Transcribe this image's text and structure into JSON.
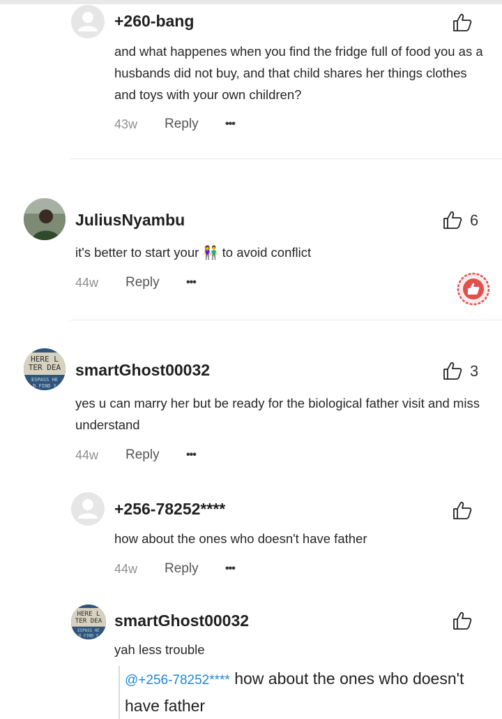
{
  "comments": [
    {
      "username": "+260-bang",
      "text": "and what happenes when you find the fridge full of food you as  a husbands did not buy, and that child shares her things clothes and toys with your own children?",
      "time": "43w",
      "reply_label": "Reply",
      "more": "•••",
      "likes": ""
    },
    {
      "username": "JuliusNyambu",
      "text_before": "it's better to start your",
      "emoji": "👫",
      "text_after": " to avoid conflict",
      "time": "44w",
      "reply_label": "Reply",
      "more": "•••",
      "likes": "6"
    },
    {
      "username": "smartGhost00032",
      "text": "yes u can marry her but be ready for the biological father visit and miss understand",
      "time": "44w",
      "reply_label": "Reply",
      "more": "•••",
      "likes": "3"
    },
    {
      "username": "+256-78252****",
      "text": "how about the ones who doesn't have father",
      "time": "44w",
      "reply_label": "Reply",
      "more": "•••",
      "likes": ""
    },
    {
      "username": "smartGhost00032",
      "text": "yah less trouble",
      "quote_mention": "@+256-78252****",
      "quote_text": " how about the ones who doesn't have father",
      "likes": ""
    }
  ],
  "avatar_text": {
    "ghost_line1": "HERE L",
    "ghost_line2": "TER DEA",
    "ghost_line3": "ESPASS HE",
    "ghost_line4": "D FIND Y"
  },
  "colors": {
    "accent_link": "#1f86d6",
    "badge_red": "#e0504d"
  },
  "icons": {
    "like": "thumbs-up-outline-icon",
    "avatar_default": "user-silhouette-icon",
    "badge": "red-thumbs-up-badge-icon"
  }
}
